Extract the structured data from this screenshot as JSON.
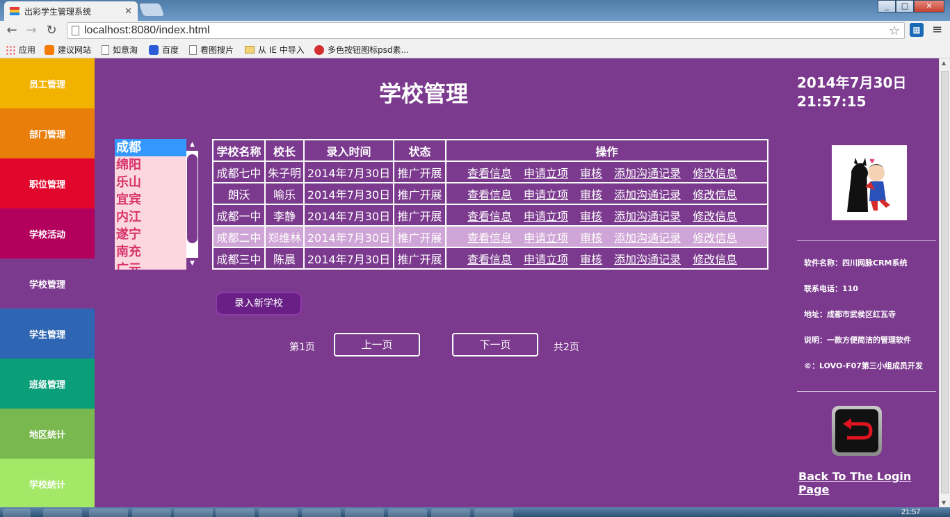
{
  "browser": {
    "tab_title": "出彩学生管理系统",
    "url": "localhost:8080/index.html",
    "bookmarks": [
      "应用",
      "建议网站",
      "如意淘",
      "百度",
      "看图搜片",
      "从 IE 中导入",
      "多色按钮图标psd素..."
    ]
  },
  "sidebar": {
    "items": [
      {
        "label": "员工管理",
        "color": "#f2b200"
      },
      {
        "label": "部门管理",
        "color": "#e97e0a"
      },
      {
        "label": "职位管理",
        "color": "#e2062c"
      },
      {
        "label": "学校活动",
        "color": "#b3005d"
      },
      {
        "label": "学校管理",
        "color": "#7b3a8e"
      },
      {
        "label": "学生管理",
        "color": "#2e66b3"
      },
      {
        "label": "班级管理",
        "color": "#0a9e79"
      },
      {
        "label": "地区统计",
        "color": "#78b84f"
      },
      {
        "label": "学校统计",
        "color": "#a3e866"
      }
    ]
  },
  "main": {
    "title": "学校管理",
    "date": "2014年7月30日",
    "time": "21:57:15",
    "cities": [
      "成都",
      "绵阳",
      "乐山",
      "宜宾",
      "内江",
      "遂宁",
      "南充",
      "广元"
    ],
    "selected_city": "成都",
    "table": {
      "headers": [
        "学校名称",
        "校长",
        "录入时间",
        "状态",
        "操作"
      ],
      "actions": [
        "查看信息",
        "申请立项",
        "审核",
        "添加沟通记录",
        "修改信息"
      ],
      "rows": [
        {
          "name": "成都七中",
          "principal": "朱子明",
          "date": "2014年7月30日",
          "status": "推广开展"
        },
        {
          "name": "朗沃",
          "principal": "喻乐",
          "date": "2014年7月30日",
          "status": "推广开展"
        },
        {
          "name": "成都一中",
          "principal": "李静",
          "date": "2014年7月30日",
          "status": "推广开展"
        },
        {
          "name": "成都二中",
          "principal": "郑维林",
          "date": "2014年7月30日",
          "status": "推广开展"
        },
        {
          "name": "成都三中",
          "principal": "陈晨",
          "date": "2014年7月30日",
          "status": "推广开展"
        }
      ]
    },
    "add_button": "录入新学校",
    "pager": {
      "current": "第1页",
      "prev": "上一页",
      "next": "下一页",
      "total": "共2页"
    }
  },
  "info_panel": {
    "software": "软件名称：四川网脉CRM系统",
    "phone": "联系电话：110",
    "address": "地址：成都市武侯区红瓦寺",
    "description": "说明：一款方便简洁的管理软件",
    "copyright": "©：LOVO-F07第三小组成员开发",
    "back_link": "Back To The Login Page"
  },
  "taskbar": {
    "clock": "21:57"
  }
}
